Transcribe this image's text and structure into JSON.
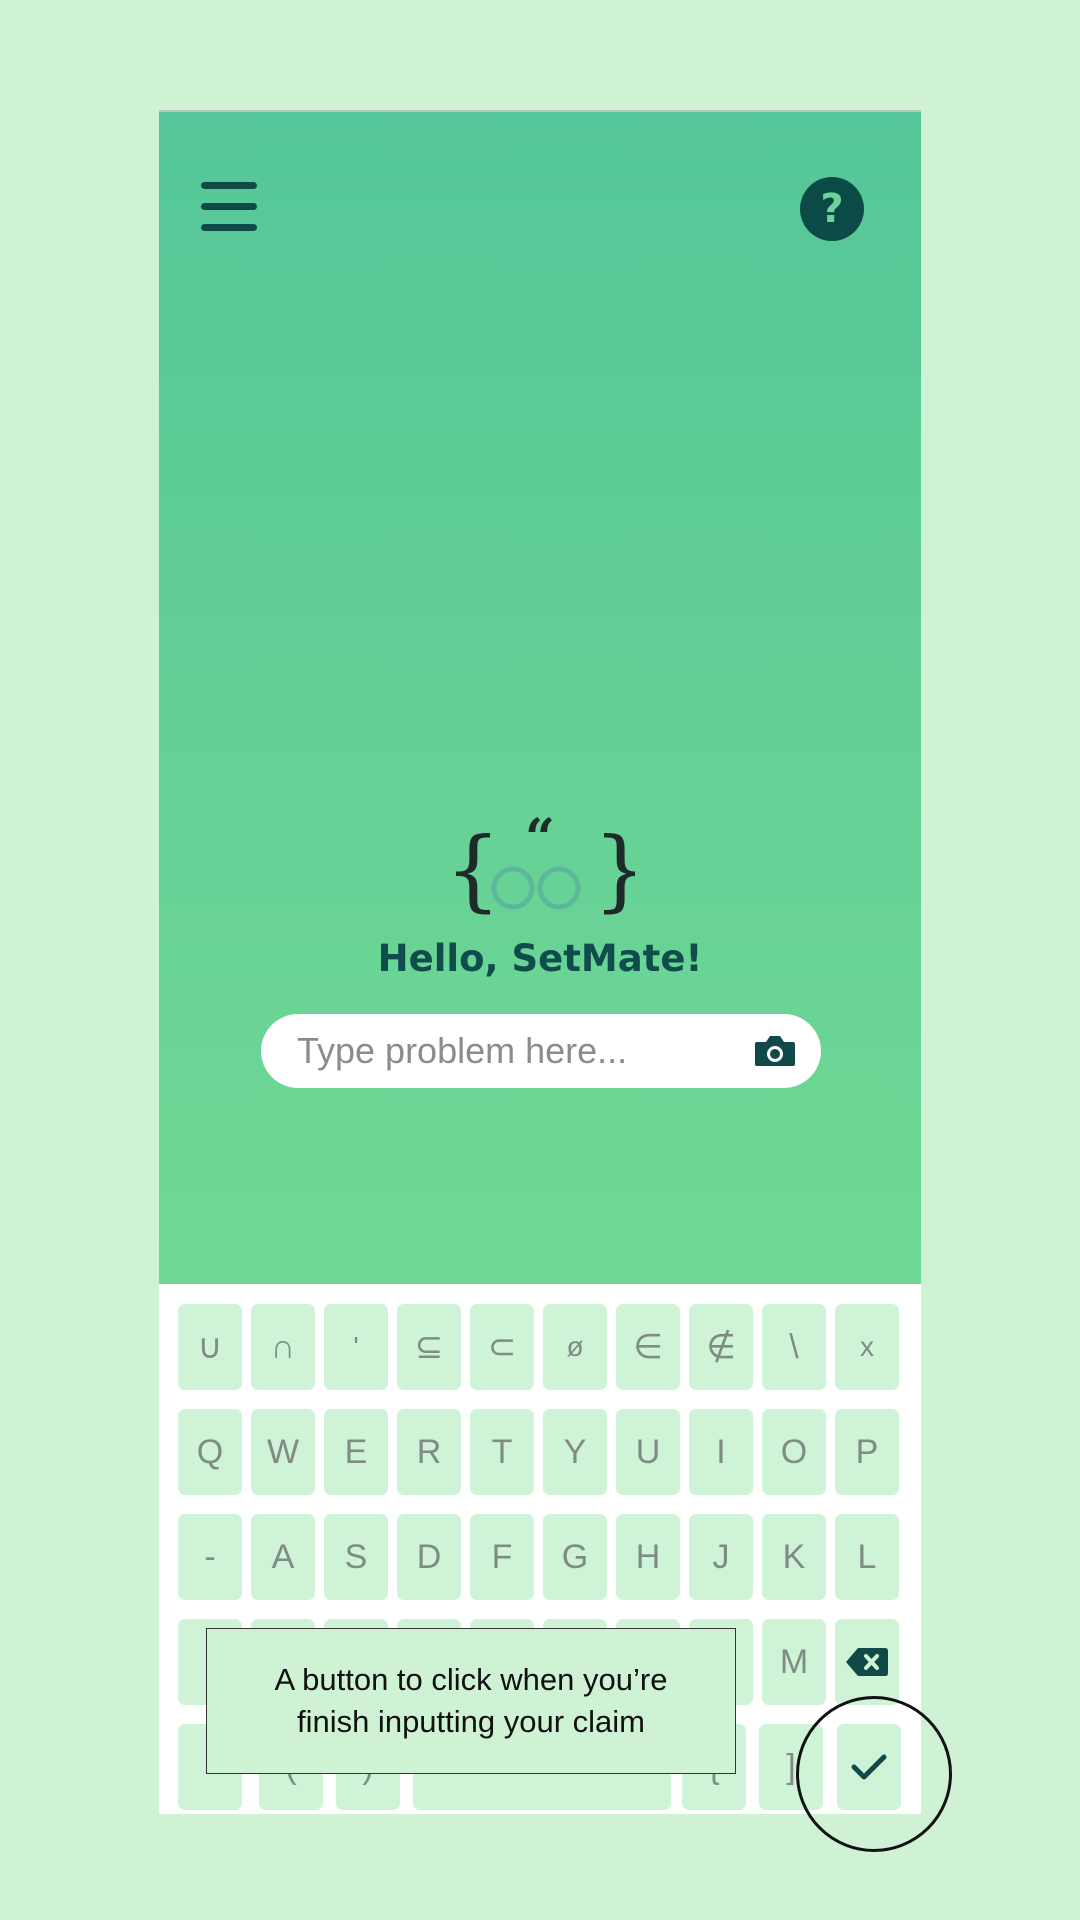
{
  "app": {
    "name": "SetMate",
    "greeting": "Hello, SetMate!",
    "help_label": "?",
    "search": {
      "placeholder": "Type problem here...",
      "value": ""
    }
  },
  "keyboard": {
    "rows": [
      [
        "∪",
        "∩",
        "'",
        "⊆",
        "⊂",
        "ø",
        "∈",
        "∉",
        "\\",
        "x"
      ],
      [
        "Q",
        "W",
        "E",
        "R",
        "T",
        "Y",
        "U",
        "I",
        "O",
        "P"
      ],
      [
        "-",
        "A",
        "S",
        "D",
        "F",
        "G",
        "H",
        "J",
        "K",
        "L"
      ],
      [
        "",
        "",
        "",
        "",
        "",
        "",
        "",
        "",
        "M"
      ],
      [
        "",
        "(",
        ")",
        "",
        "{",
        "]"
      ]
    ]
  },
  "tooltip": {
    "line1": "A button to click when you’re",
    "line2": "finish inputting your claim"
  },
  "colors": {
    "page_bg": "#cff2d4",
    "gradient_top": "#55c699",
    "gradient_bottom": "#6fd894",
    "dark_teal": "#0f4a48",
    "key_bg": "#cff3d6"
  },
  "icons": {
    "menu": "hamburger-menu-icon",
    "help": "question-mark-icon",
    "camera": "camera-icon",
    "backspace": "backspace-icon",
    "submit": "checkmark-icon"
  }
}
